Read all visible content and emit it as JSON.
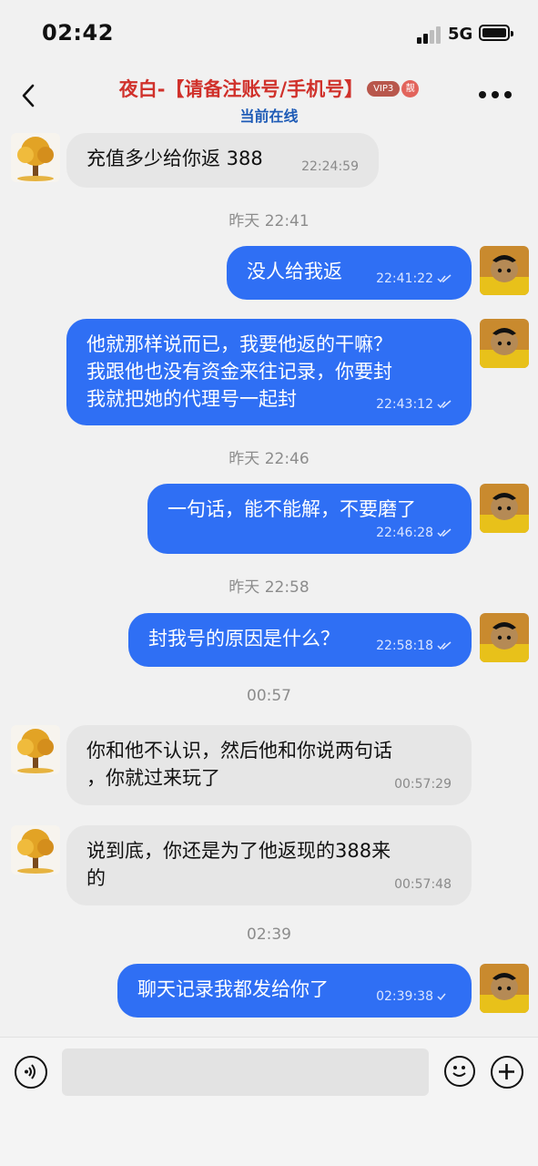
{
  "status_bar": {
    "time": "02:42",
    "network": "5G"
  },
  "header": {
    "title": "夜白-【请备注账号/手机号】",
    "vip_badge": "VIP3",
    "liang_badge": "靓",
    "subtitle": "当前在线"
  },
  "messages": [
    {
      "side": "in",
      "avatar": "golden-tree-avatar",
      "text": "充值多少给你返 388",
      "time": "22:24:59"
    },
    {
      "type": "date",
      "text": "昨天 22:41"
    },
    {
      "side": "out",
      "avatar": "cat-avatar",
      "text": "没人给我返",
      "time": "22:41:22",
      "read": true
    },
    {
      "side": "out",
      "avatar": "cat-avatar",
      "text": "他就那样说而已，我要他返的干嘛？\n我跟他也没有资金来往记录，你要封\n我就把她的代理号一起封",
      "time": "22:43:12",
      "read": true
    },
    {
      "type": "date",
      "text": "昨天 22:46"
    },
    {
      "side": "out",
      "avatar": "cat-avatar",
      "text": "一句话，能不能解，不要磨了",
      "time": "22:46:28",
      "read": true
    },
    {
      "type": "date",
      "text": "昨天 22:58"
    },
    {
      "side": "out",
      "avatar": "cat-avatar",
      "text": "封我号的原因是什么？",
      "time": "22:58:18",
      "read": true
    },
    {
      "type": "date",
      "text": "00:57"
    },
    {
      "side": "in",
      "avatar": "golden-tree-avatar",
      "text": "你和他不认识，然后他和你说两句话\n，你就过来玩了",
      "time": "00:57:29"
    },
    {
      "side": "in",
      "avatar": "golden-tree-avatar",
      "text": "说到底，你还是为了他返现的388来\n的",
      "time": "00:57:48"
    },
    {
      "type": "date",
      "text": "02:39"
    },
    {
      "side": "out",
      "avatar": "cat-avatar",
      "text": "聊天记录我都发给你了",
      "time": "02:39:38",
      "read": true
    }
  ],
  "colors": {
    "outgoing_bubble": "#2f6ff4",
    "incoming_bubble": "#e6e6e6",
    "title": "#d0312b",
    "subtitle": "#1e5bb6"
  },
  "input_bar": {
    "icons": [
      "voice-icon",
      "emoji-icon",
      "plus-icon"
    ]
  }
}
